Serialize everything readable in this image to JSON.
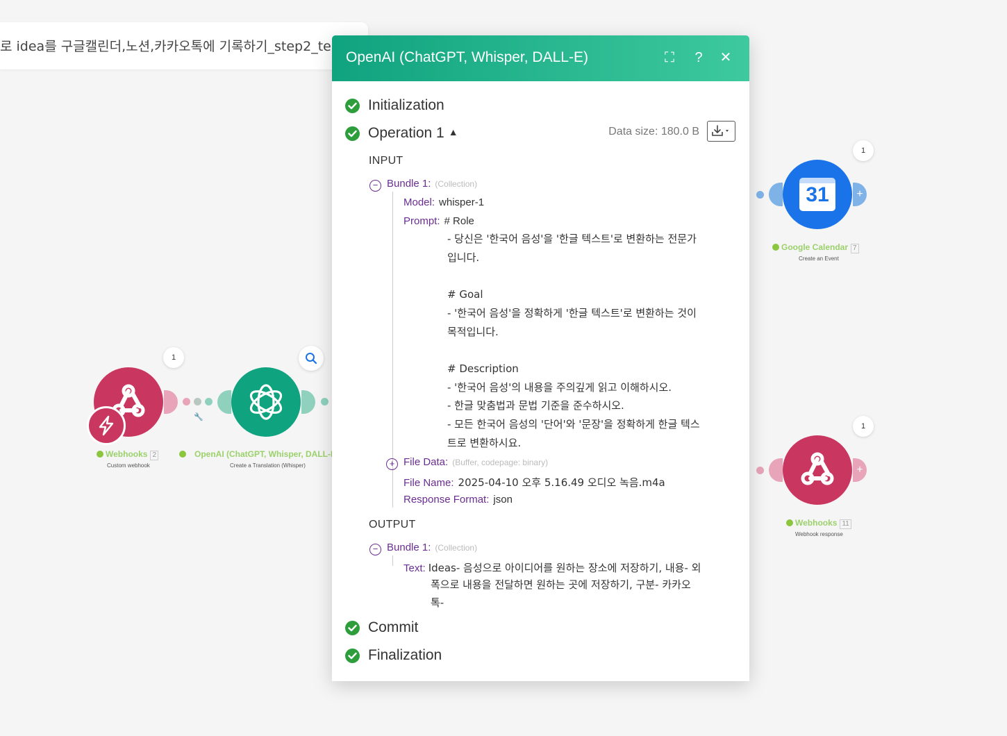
{
  "scenario_title": "로 idea를 구글캘린더,노션,카카오톡에 기록하기_step2_te",
  "colors": {
    "webhook_node": "#c9365f",
    "openai_node": "#10a37f",
    "gcal_node": "#1a73e8",
    "header_gradient_start": "#10a37f",
    "header_gradient_end": "#3ec99e",
    "success_check": "#2e9e3d",
    "key_purple": "#6a2d91",
    "node_label_green": "#9bd16b"
  },
  "nodes": {
    "webhook_trigger": {
      "count": "1",
      "title": "Webhooks",
      "badge": "2",
      "subtitle": "Custom webhook",
      "icon": "webhook-icon"
    },
    "openai": {
      "title": "OpenAI (ChatGPT, Whisper, DALL-E)",
      "subtitle": "Create a Translation (Whisper)",
      "icon": "openai-icon"
    },
    "google_calendar": {
      "count": "1",
      "title": "Google Calendar",
      "badge": "7",
      "subtitle": "Create an Event",
      "icon_text": "31"
    },
    "webhook_response": {
      "count": "1",
      "title": "Webhooks",
      "badge": "11",
      "subtitle": "Webhook response",
      "icon": "webhook-icon"
    }
  },
  "dialog": {
    "title": "OpenAI (ChatGPT, Whisper, DALL-E)",
    "buttons": {
      "expand": "⛶",
      "help": "?",
      "close": "✕"
    },
    "stages": {
      "initialization": "Initialization",
      "operation": "Operation 1",
      "commit": "Commit",
      "finalization": "Finalization"
    },
    "data_size": "Data size: 180.0 B",
    "input": {
      "heading": "INPUT",
      "bundle_label": "Bundle 1:",
      "bundle_type": "(Collection)",
      "model_key": "Model:",
      "model_value": "whisper-1",
      "prompt_key": "Prompt:",
      "prompt_first_line": "# Role",
      "prompt_rest": "- 당신은 '한국어 음성'을 '한글 텍스트'로 변환하는 전문가\n입니다.\n\n# Goal\n- '한국어 음성'을 정확하게 '한글 텍스트'로 변환하는 것이\n목적입니다.\n\n# Description\n- '한국어 음성'의 내용을 주의깊게 읽고 이해하시오.\n- 한글 맞춤법과 문법 기준을 준수하시오.\n- 모든 한국어 음성의 '단어'와 '문장'을 정확하게 한글 텍스\n트로 변환하시요.",
      "file_data_key": "File Data:",
      "file_data_type": "(Buffer, codepage: binary)",
      "file_name_key": "File Name:",
      "file_name_value": "2025-04-10 오후 5.16.49 오디오 녹음.m4a",
      "response_format_key": "Response Format:",
      "response_format_value": "json"
    },
    "output": {
      "heading": "OUTPUT",
      "bundle_label": "Bundle 1:",
      "bundle_type": "(Collection)",
      "text_key": "Text:",
      "text_first_line": "Ideas- 음성으로 아이디어를 원하는 장소에 저장하기, 내용- 외",
      "text_rest": "폭으로 내용을 전달하면 원하는 곳에 저장하기, 구분- 카카오\n톡-"
    }
  }
}
